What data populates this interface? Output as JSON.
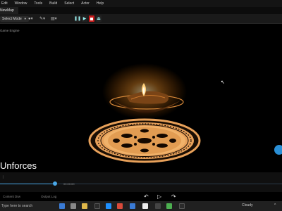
{
  "menu": [
    "Edit",
    "Window",
    "Tools",
    "Build",
    "Select",
    "Actor",
    "Help"
  ],
  "tab_title": "NewMap",
  "toolbar": {
    "mode_label": "Select Mode"
  },
  "viewport": {
    "label": "Game Engine",
    "caption": "Unforces"
  },
  "timeline": {
    "marker": "00:00:00",
    "playhead_percent": 19.5,
    "bottom_left": "Content Drw",
    "bottom_right": "Output Log"
  },
  "taskbar": {
    "search_placeholder": "Type here to search",
    "weather": "Cloudy"
  },
  "colors": {
    "flame": "#ffb347",
    "mandala": "#e8a15a",
    "accent": "#2a8fd6"
  }
}
